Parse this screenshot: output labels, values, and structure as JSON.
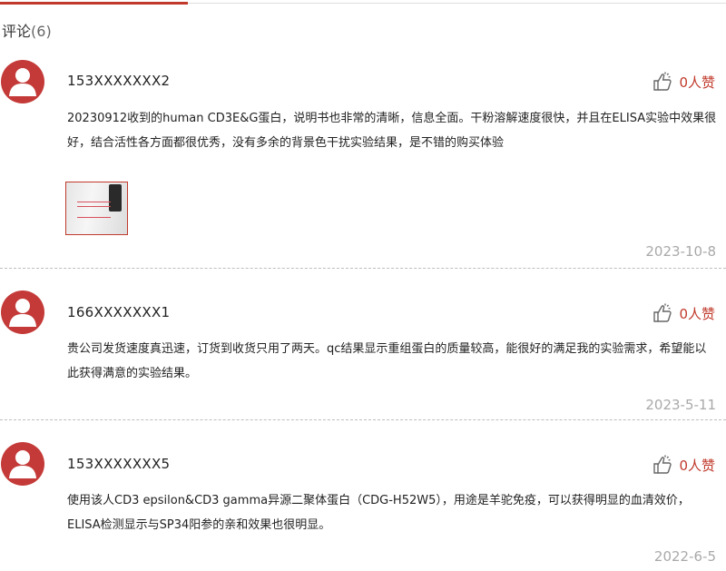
{
  "header": {
    "title": "评论",
    "count": "(6)"
  },
  "comments": [
    {
      "user": "153XXXXXXX2",
      "likes": "0人赞",
      "text": "20230912收到的human CD3E&G蛋白，说明书也非常的清晰，信息全面。干粉溶解速度很快，并且在ELISA实验中效果很好，结合活性各方面都很优秀，没有多余的背景色干扰实验结果，是不错的购买体验",
      "date": "2023-10-8",
      "has_image": true
    },
    {
      "user": "166XXXXXXX1",
      "likes": "0人赞",
      "text": "贵公司发货速度真迅速，订货到收货只用了两天。qc结果显示重组蛋白的质量较高，能很好的满足我的实验需求，希望能以此获得满意的实验结果。",
      "date": "2023-5-11",
      "has_image": false
    },
    {
      "user": "153XXXXXXX5",
      "likes": "0人赞",
      "text": "使用该人CD3 epsilon&CD3 gamma异源二聚体蛋白（CDG-H52W5），用途是羊驼免疫，可以获得明显的血清效价，ELISA检测显示与SP34阳参的亲和效果也很明显。",
      "date": "2022-6-5",
      "has_image": false
    }
  ],
  "colors": {
    "accent": "#c0392b",
    "avatar": "#c43a38",
    "date": "#a9a9a9"
  },
  "icons": {
    "avatar": "user-avatar-icon",
    "like": "thumbs-up-icon"
  }
}
